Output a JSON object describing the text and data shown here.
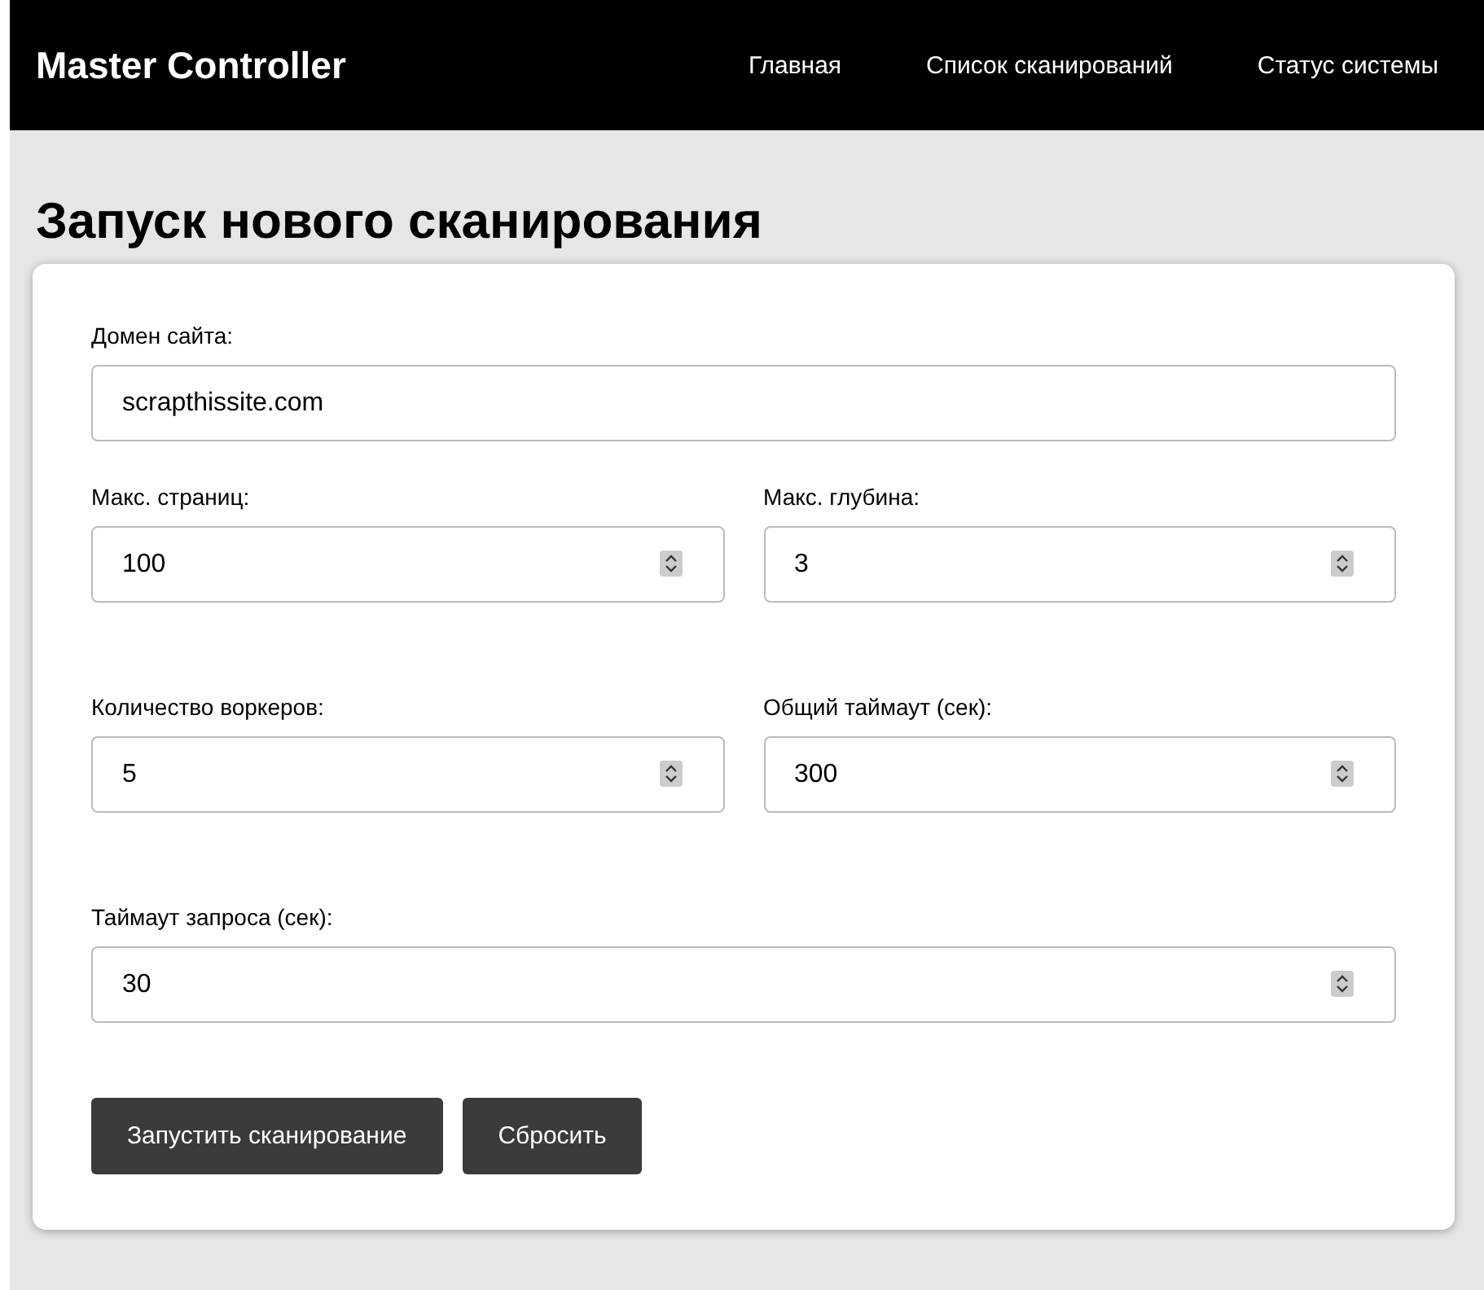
{
  "header": {
    "brand": "Master Controller",
    "nav": [
      {
        "label": "Главная"
      },
      {
        "label": "Список сканирований"
      },
      {
        "label": "Статус системы"
      }
    ]
  },
  "title": "Запуск нового сканирования",
  "form": {
    "rows": [
      {
        "fields": [
          {
            "label": "Домен сайта:",
            "value": "scrapthissite.com",
            "kind": "text"
          }
        ]
      },
      {
        "fields": [
          {
            "label": "Макс. страниц:",
            "value": "100",
            "kind": "number"
          },
          {
            "label": "Макс. глубина:",
            "value": "3",
            "kind": "number"
          }
        ]
      },
      {
        "fields": [
          {
            "label": "Количество воркеров:",
            "value": "5",
            "kind": "number"
          },
          {
            "label": "Общий таймаут (сек):",
            "value": "300",
            "kind": "number"
          }
        ]
      },
      {
        "fields": [
          {
            "label": "Таймаут запроса (сек):",
            "value": "30",
            "kind": "number"
          }
        ]
      }
    ],
    "buttons": [
      {
        "label": "Запустить сканирование"
      },
      {
        "label": "Сбросить"
      }
    ]
  }
}
